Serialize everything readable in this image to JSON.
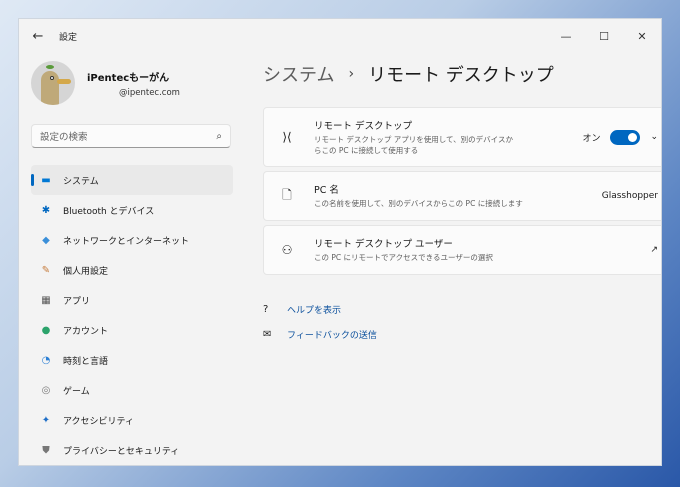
{
  "window": {
    "title": "設定",
    "back": "←",
    "minimize": "—",
    "maximize": "☐",
    "close": "✕"
  },
  "profile": {
    "name": "iPentecもーがん",
    "email": "@ipentec.com"
  },
  "search": {
    "placeholder": "設定の検索",
    "icon": "⌕"
  },
  "nav": [
    {
      "label": "システム",
      "icon": "▬",
      "color": "#0078d4"
    },
    {
      "label": "Bluetooth とデバイス",
      "icon": "✱",
      "color": "#0067c0"
    },
    {
      "label": "ネットワークとインターネット",
      "icon": "◆",
      "color": "#3a8fd9"
    },
    {
      "label": "個人用設定",
      "icon": "✎",
      "color": "#c57a3a"
    },
    {
      "label": "アプリ",
      "icon": "▦",
      "color": "#555"
    },
    {
      "label": "アカウント",
      "icon": "●",
      "color": "#2ba36b"
    },
    {
      "label": "時刻と言語",
      "icon": "◔",
      "color": "#2b7fd4"
    },
    {
      "label": "ゲーム",
      "icon": "◎",
      "color": "#777"
    },
    {
      "label": "アクセシビリティ",
      "icon": "✦",
      "color": "#1f6fc7"
    },
    {
      "label": "プライバシーとセキュリティ",
      "icon": "⛊",
      "color": "#777"
    }
  ],
  "breadcrumb": {
    "parent": "システム",
    "sep": "›",
    "current": "リモート デスクトップ"
  },
  "cards": [
    {
      "title": "リモート デスクトップ",
      "desc": "リモート デスクトップ アプリを使用して、別のデバイスからこの PC に接続して使用する",
      "icon": "⟩⟨",
      "state": "オン",
      "toggle": true,
      "chevron": "⌄"
    },
    {
      "title": "PC 名",
      "desc": "この名前を使用して、別のデバイスからこの PC に接続します",
      "icon": "🗋",
      "value": "Glasshopper"
    },
    {
      "title": "リモート デスクトップ ユーザー",
      "desc": "この PC にリモートでアクセスできるユーザーの選択",
      "icon": "⚇",
      "action": "↗"
    }
  ],
  "links": [
    {
      "label": "ヘルプを表示",
      "icon": "?"
    },
    {
      "label": "フィードバックの送信",
      "icon": "✉"
    }
  ]
}
